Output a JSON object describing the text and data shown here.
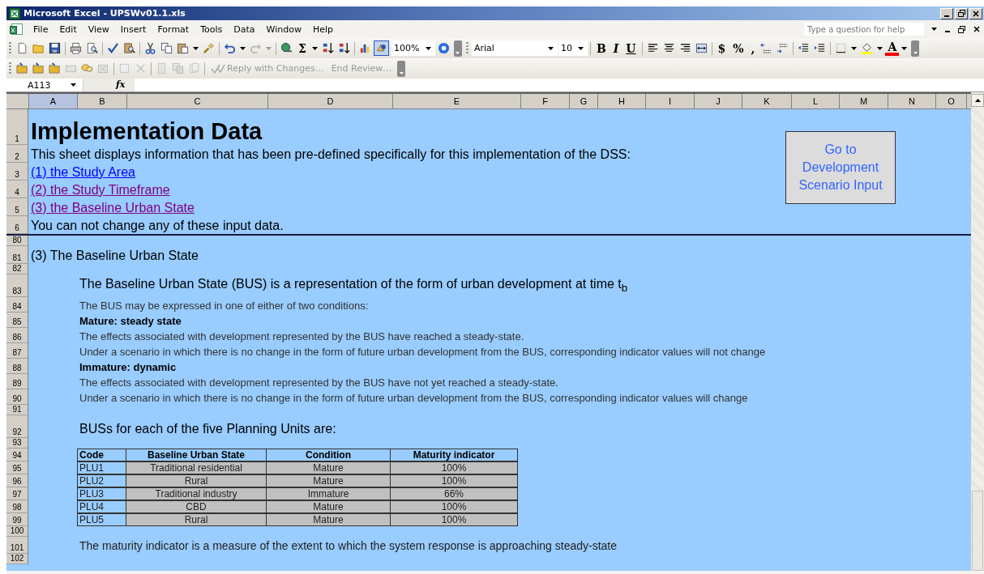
{
  "window": {
    "title": "Microsoft Excel - UPSWv01.1.xls"
  },
  "menu": [
    "File",
    "Edit",
    "View",
    "Insert",
    "Format",
    "Tools",
    "Data",
    "Window",
    "Help"
  ],
  "help_search": {
    "placeholder": "Type a question for help"
  },
  "standard_toolbar": {
    "sum": "Σ",
    "zoom": "100%"
  },
  "formatting_toolbar": {
    "font": "Arial",
    "size": "10",
    "bold": "B",
    "italic": "I",
    "underline": "U",
    "currency": "$",
    "percent": "%",
    "comma": ",",
    "font_color": "A"
  },
  "reviewing_toolbar": {
    "reply": "Reply with Changes…",
    "end_review": "End Review…"
  },
  "formula_bar": {
    "name_box": "A113",
    "fx": "fx"
  },
  "columns": [
    {
      "label": "A",
      "selected": true
    },
    {
      "label": "B",
      "selected": false
    },
    {
      "label": "C",
      "selected": false
    },
    {
      "label": "D",
      "selected": false
    },
    {
      "label": "E",
      "selected": false
    },
    {
      "label": "F",
      "selected": false
    },
    {
      "label": "G",
      "selected": false
    },
    {
      "label": "H",
      "selected": false
    },
    {
      "label": "I",
      "selected": false
    },
    {
      "label": "J",
      "selected": false
    },
    {
      "label": "K",
      "selected": false
    },
    {
      "label": "L",
      "selected": false
    },
    {
      "label": "M",
      "selected": false
    },
    {
      "label": "N",
      "selected": false
    },
    {
      "label": "O",
      "selected": false
    }
  ],
  "frozen_rows": [
    {
      "number": "1",
      "kind": "title",
      "text": "Implementation Data"
    },
    {
      "number": "2",
      "kind": "text",
      "text": "This sheet displays information that has been pre-defined specifically for this implementation of the DSS:"
    },
    {
      "number": "3",
      "kind": "link",
      "text": "(1) the Study Area",
      "visited": false
    },
    {
      "number": "4",
      "kind": "link",
      "text": "(2) the Study Timeframe",
      "visited": true
    },
    {
      "number": "5",
      "kind": "link",
      "text": "(3) the Baseline Urban State",
      "visited": true
    },
    {
      "number": "6",
      "kind": "text",
      "text": "You can not change any of these input data."
    }
  ],
  "go_button": "Go to Development Scenario Input",
  "rows": [
    {
      "number": "80",
      "kind": "blank"
    },
    {
      "number": "81",
      "kind": "heading",
      "text": "(3) The Baseline Urban State"
    },
    {
      "number": "82",
      "kind": "blank"
    },
    {
      "number": "83",
      "kind": "subheading",
      "text": "The Baseline Urban State (BUS) is a representation of the form of urban development at time t$_{b}$"
    },
    {
      "number": "84",
      "kind": "note",
      "text": "The BUS may be expressed in one of either of two conditions:"
    },
    {
      "number": "85",
      "kind": "bold_note",
      "text": "Mature: steady state"
    },
    {
      "number": "86",
      "kind": "note",
      "text": "The effects associated with development represented by the BUS have reached a steady-state."
    },
    {
      "number": "87",
      "kind": "note",
      "text": "Under a scenario in which there is no change in the form of future urban development from the BUS, corresponding indicator values will not change"
    },
    {
      "number": "88",
      "kind": "bold_note",
      "text": "Immature: dynamic"
    },
    {
      "number": "89",
      "kind": "note",
      "text": "The effects associated with development represented by the BUS have not yet reached a steady-state."
    },
    {
      "number": "90",
      "kind": "note",
      "text": "Under a scenario in which there is no change in the form of future urban development from the BUS, corresponding indicator values will change"
    },
    {
      "number": "91",
      "kind": "blank"
    },
    {
      "number": "92",
      "kind": "subheading",
      "text": "BUSs for each of the five Planning Units are:"
    },
    {
      "number": "93",
      "kind": "blank"
    },
    {
      "number": "94",
      "kind": "table_header",
      "cells": [
        "Code",
        "Baseline Urban State",
        "Condition",
        "Maturity indicator"
      ]
    },
    {
      "number": "95",
      "kind": "table_row",
      "cells": [
        "PLU1",
        "Traditional residential",
        "Mature",
        "100%"
      ]
    },
    {
      "number": "96",
      "kind": "table_row",
      "cells": [
        "PLU2",
        "Rural",
        "Mature",
        "100%"
      ]
    },
    {
      "number": "97",
      "kind": "table_row",
      "cells": [
        "PLU3",
        "Traditional industry",
        "Immature",
        "66%"
      ]
    },
    {
      "number": "98",
      "kind": "table_row",
      "cells": [
        "PLU4",
        "CBD",
        "Mature",
        "100%"
      ]
    },
    {
      "number": "99",
      "kind": "table_row",
      "cells": [
        "PLU5",
        "Rural",
        "Mature",
        "100%"
      ]
    },
    {
      "number": "100",
      "kind": "blank"
    },
    {
      "number": "101",
      "kind": "footnote",
      "text": "The maturity indicator is a measure of the extent to which the system response is approaching steady-state"
    },
    {
      "number": "102",
      "kind": "blank"
    }
  ]
}
